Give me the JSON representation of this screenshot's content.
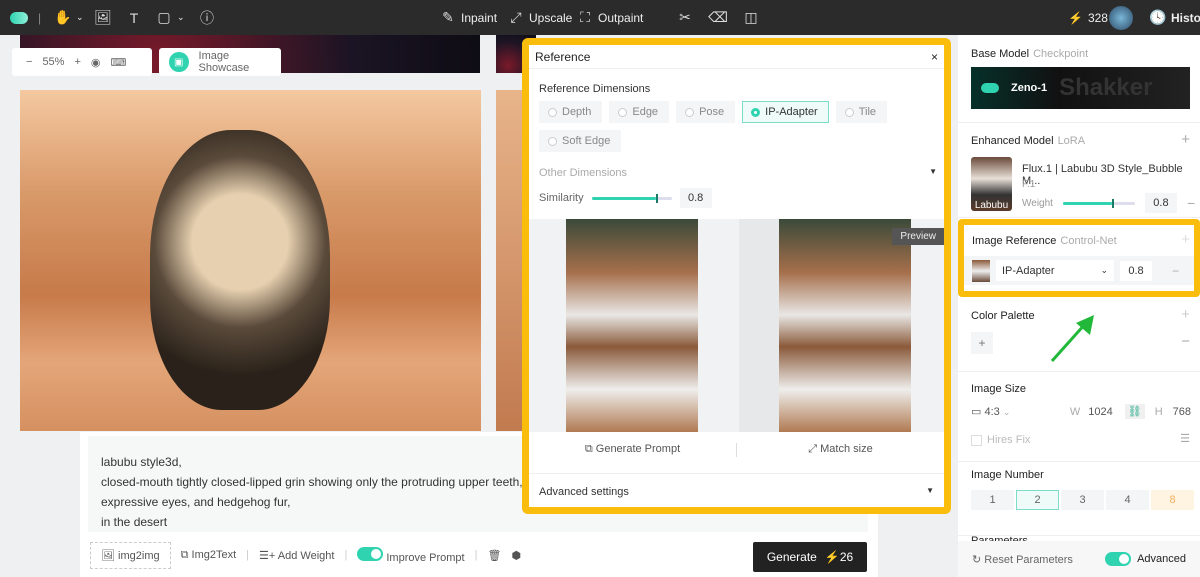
{
  "toolbar": {
    "inpaint": "Inpaint",
    "upscale": "Upscale",
    "outpaint": "Outpaint",
    "credits": "328",
    "history": "History"
  },
  "canvas": {
    "zoom": "55%",
    "showcase": "Image Showcase"
  },
  "prompt": {
    "lines": [
      "labubu style3d,",
      "closed-mouth tightly closed-lipped grin showing only the protruding upper teeth, w",
      "expressive eyes, and hedgehog fur,",
      "in the desert"
    ],
    "img2img": "img2img",
    "img2text": "Img2Text",
    "add_weight": "Add Weight",
    "improve_prompt": "Improve Prompt",
    "generate": "Generate",
    "generate_cost": "26"
  },
  "reference": {
    "title": "Reference",
    "dimensions_label": "Reference Dimensions",
    "options": [
      "Depth",
      "Edge",
      "Pose",
      "IP-Adapter",
      "Tile",
      "Soft Edge"
    ],
    "selected": "IP-Adapter",
    "other_dimensions": "Other Dimensions",
    "similarity_label": "Similarity",
    "similarity": "0.8",
    "similarity_value": 0.8,
    "preview_label": "Preview",
    "generate_prompt": "Generate Prompt",
    "match_size": "Match size",
    "advanced": "Advanced settings"
  },
  "panel": {
    "base_model": {
      "title": "Base Model",
      "sub": "Checkpoint",
      "name": "Zeno-1",
      "watermark": "Shakker"
    },
    "enhanced": {
      "title": "Enhanced Model",
      "sub": "LoRA",
      "name": "Flux.1 | Labubu 3D Style_Bubble M...",
      "type": "F.1",
      "weight_label": "Weight",
      "weight": "0.8",
      "thumb_label": "Labubu"
    },
    "image_ref": {
      "title": "Image Reference",
      "sub": "Control-Net",
      "type": "IP-Adapter",
      "value": "0.8"
    },
    "palette": {
      "title": "Color Palette"
    },
    "size": {
      "title": "Image Size",
      "ratio": "4:3",
      "w_label": "W",
      "w": "1024",
      "h_label": "H",
      "h": "768",
      "hires": "Hires Fix"
    },
    "number": {
      "title": "Image Number",
      "options": [
        "1",
        "2",
        "3",
        "4",
        "8"
      ],
      "selected": "2"
    },
    "params": {
      "title": "Parameters"
    },
    "reset": "Reset Parameters",
    "advanced": "Advanced"
  },
  "colors": {
    "accent": "#2fd3b0",
    "highlight": "#fbbd0b",
    "arrow": "#22b83a"
  }
}
